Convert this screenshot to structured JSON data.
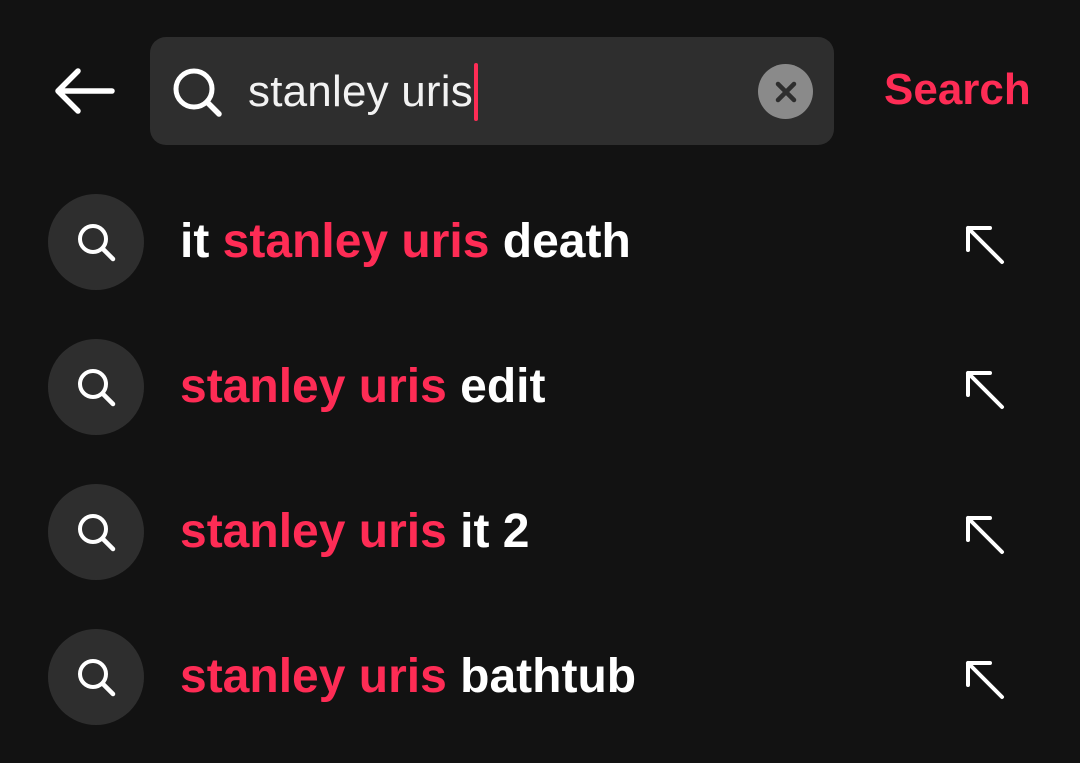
{
  "search": {
    "query": "stanley uris",
    "submit_label": "Search"
  },
  "suggestions": [
    {
      "before": "it ",
      "match": "stanley uris",
      "after": " death"
    },
    {
      "before": "",
      "match": "stanley uris",
      "after": " edit"
    },
    {
      "before": "",
      "match": "stanley uris",
      "after": " it 2"
    },
    {
      "before": "",
      "match": "stanley uris",
      "after": " bathtub"
    }
  ],
  "colors": {
    "background": "#121212",
    "accent": "#fe2c55",
    "surface": "#2e2e2e",
    "text": "#ffffff"
  },
  "icons": {
    "back": "arrow-left-icon",
    "search": "search-icon",
    "clear": "clear-x-icon",
    "fill": "arrow-up-left-icon"
  }
}
